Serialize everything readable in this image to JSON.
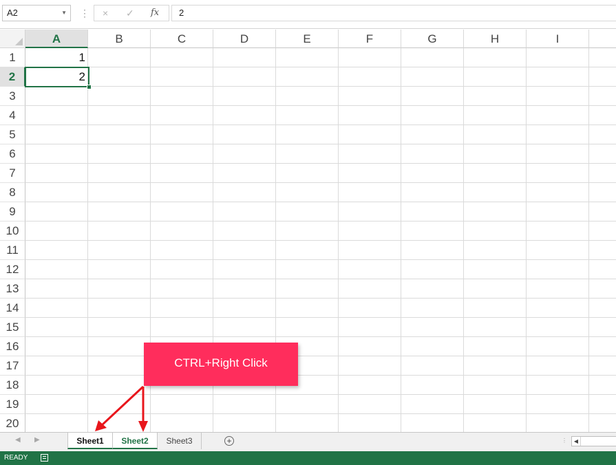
{
  "formula_bar": {
    "name_box": "A2",
    "cancel_icon": "×",
    "enter_icon": "✓",
    "fx_label": "fx",
    "formula_value": "2"
  },
  "grid": {
    "columns": [
      "A",
      "B",
      "C",
      "D",
      "E",
      "F",
      "G",
      "H",
      "I"
    ],
    "active_column": "A",
    "rows": [
      "1",
      "2",
      "3",
      "4",
      "5",
      "6",
      "7",
      "8",
      "9",
      "10",
      "11",
      "12",
      "13",
      "14",
      "15",
      "16",
      "17",
      "18",
      "19",
      "20"
    ],
    "active_row": "2",
    "cells": {
      "A1": "1",
      "A2": "2"
    }
  },
  "sheet_tabs": [
    {
      "label": "Sheet1",
      "state": "grouped"
    },
    {
      "label": "Sheet2",
      "state": "active"
    },
    {
      "label": "Sheet3",
      "state": "inactive"
    }
  ],
  "add_sheet_icon": "+",
  "status_bar": {
    "mode": "READY"
  },
  "annotation": {
    "callout_text": "CTRL+Right Click"
  },
  "colors": {
    "accent": "#217346",
    "callout": "#ff2d5c",
    "arrow": "#e8161c"
  }
}
